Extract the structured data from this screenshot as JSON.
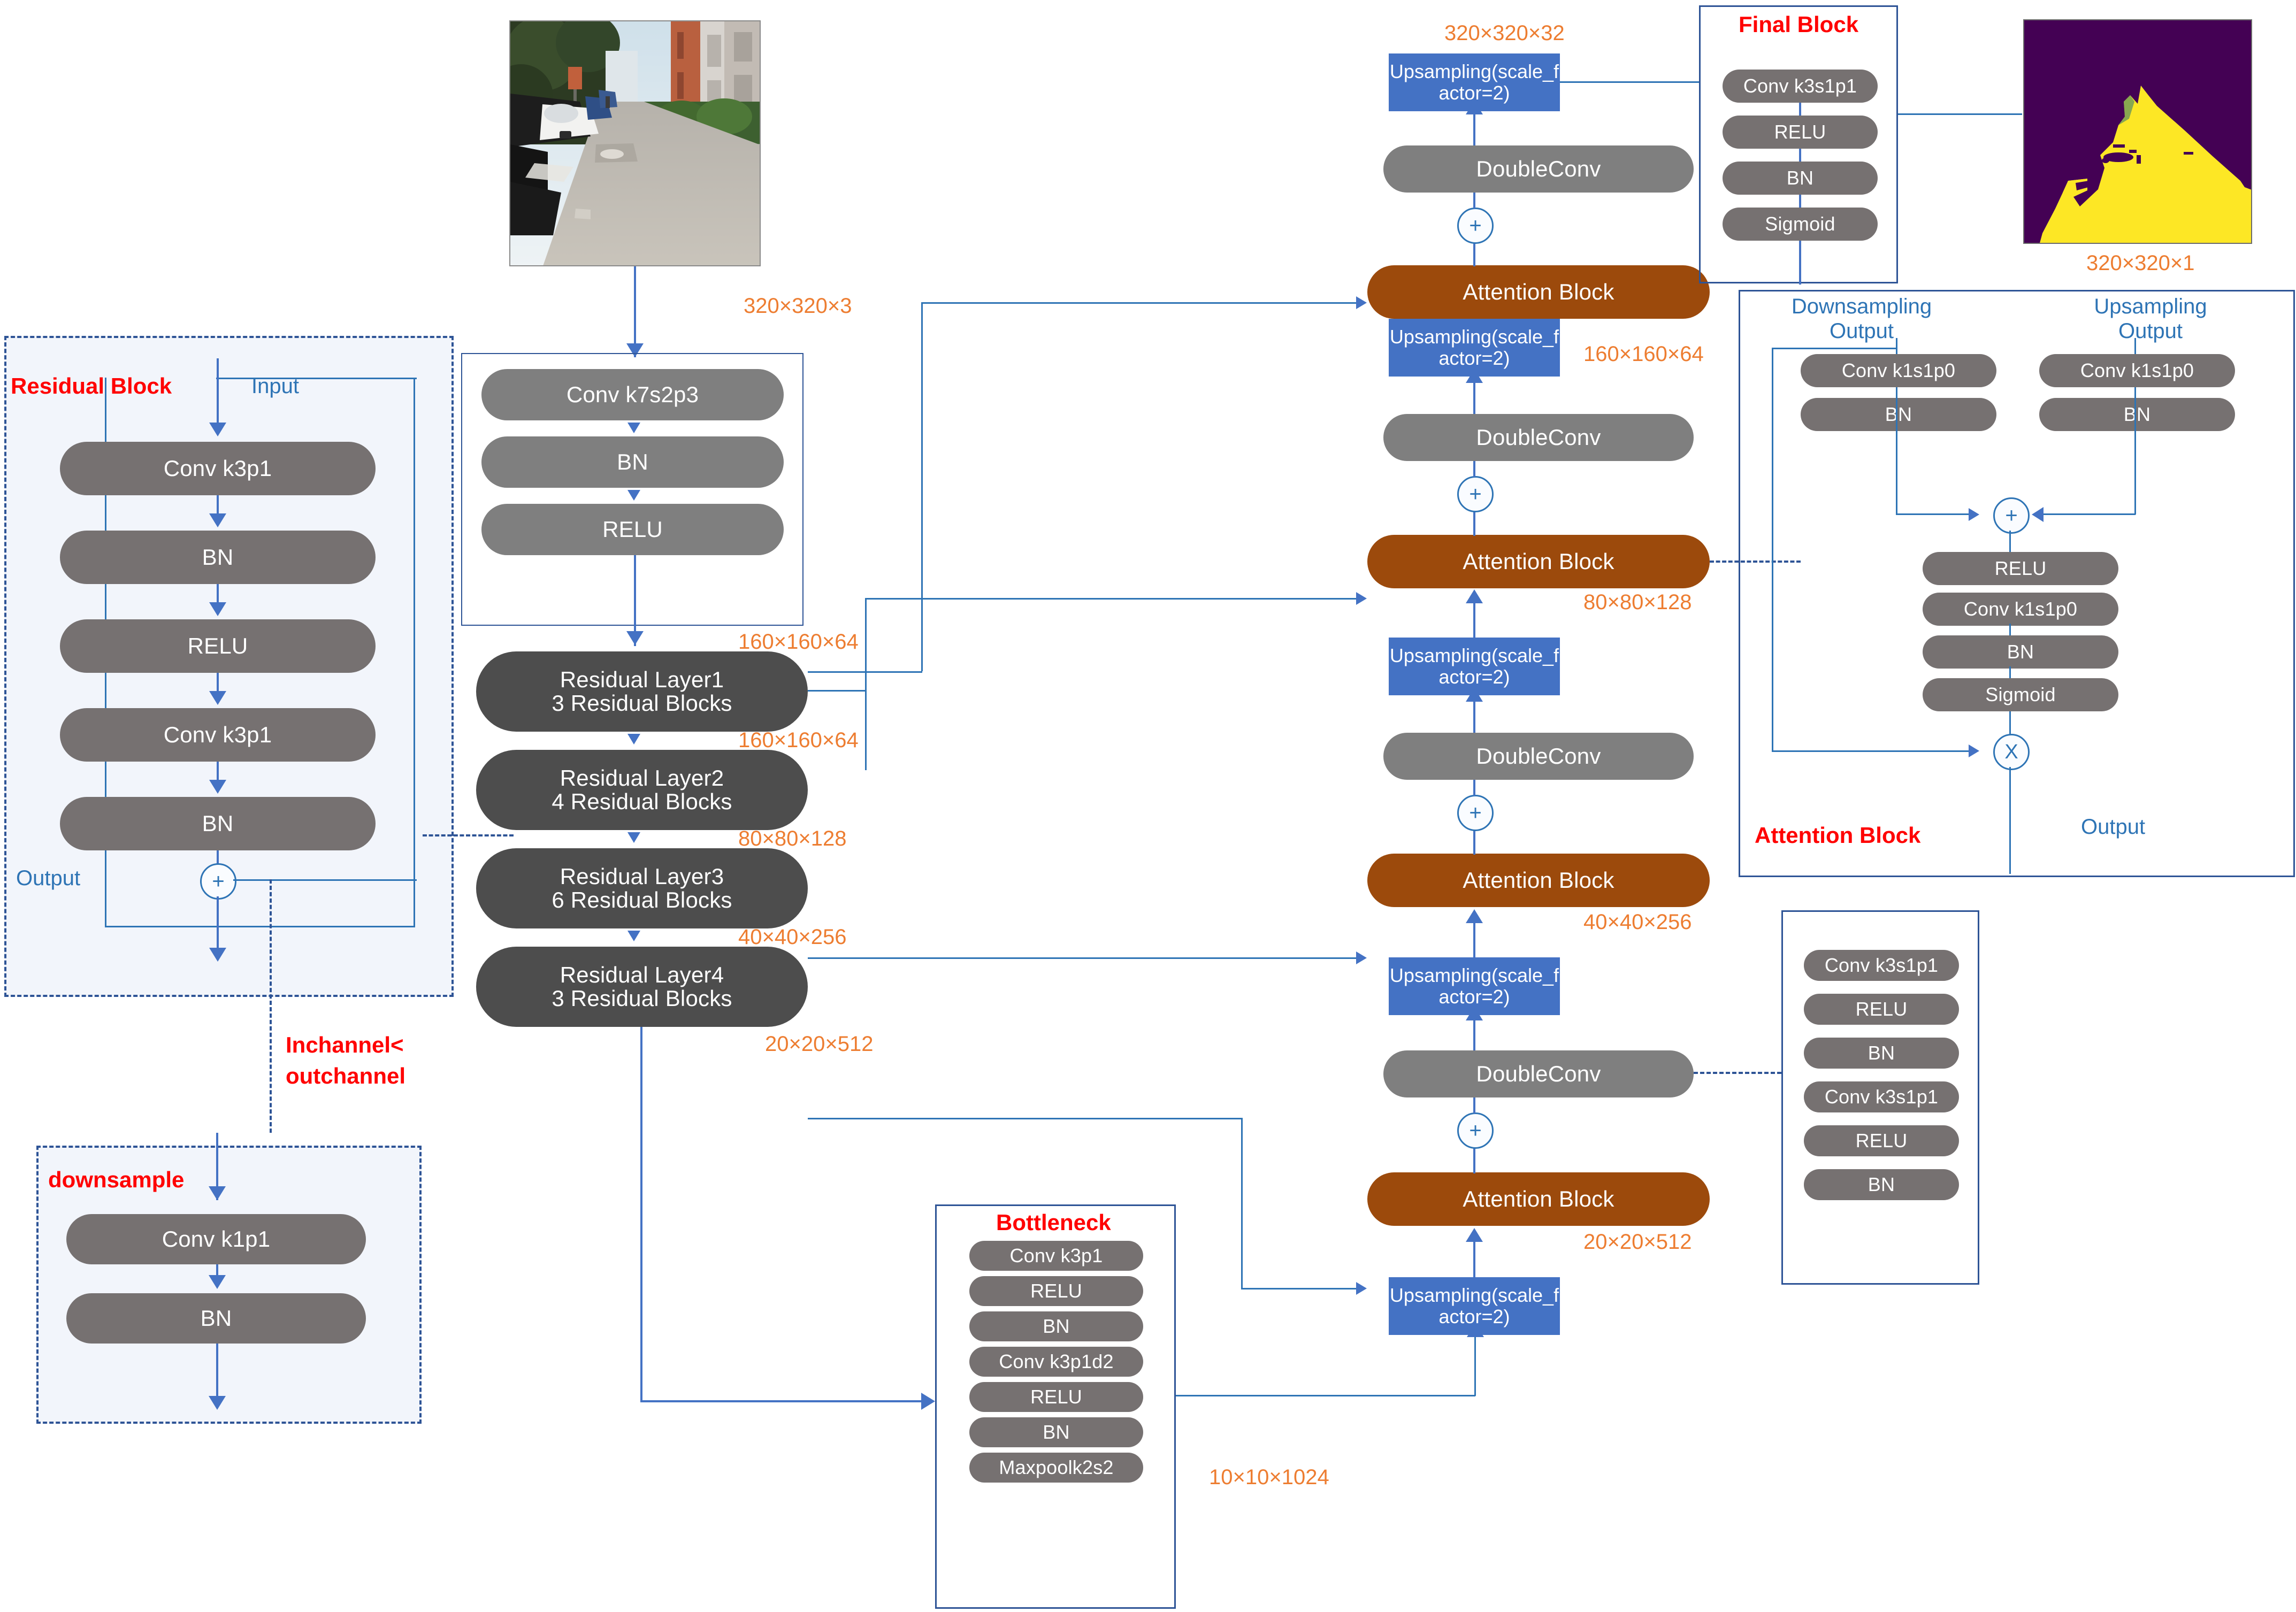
{
  "figure": {
    "type": "neural-network-architecture-diagram",
    "title": "Attention ResUNet segmentation architecture"
  },
  "encoder": {
    "input_image_caption": "320×320×3",
    "stem": {
      "layers": [
        "Conv k7s2p3",
        "BN",
        "RELU"
      ],
      "output_label": "160×160×64"
    },
    "residual_layers": [
      {
        "name": "Residual Layer1",
        "blocks": "3 Residual Blocks",
        "output_label": "160×160×64"
      },
      {
        "name": "Residual Layer2",
        "blocks": "4 Residual Blocks",
        "output_label": "80×80×128"
      },
      {
        "name": "Residual Layer3",
        "blocks": "6 Residual Blocks",
        "output_label": "40×40×256"
      },
      {
        "name": "Residual Layer4",
        "blocks": "3 Residual Blocks",
        "output_label": "20×20×512"
      }
    ]
  },
  "residual_block_panel": {
    "title": "Residual Block",
    "input_label": "Input",
    "output_label": "Output",
    "layers": [
      "Conv k3p1",
      "BN",
      "RELU",
      "Conv k3p1",
      "BN"
    ],
    "sum_symbol": "+",
    "condition_label": "Inchannel<\noutchannel",
    "condition_line1": "Inchannel<",
    "condition_line2": "outchannel"
  },
  "downsample_panel": {
    "title": "downsample",
    "layers": [
      "Conv k1p1",
      "BN"
    ]
  },
  "bottleneck_panel": {
    "title": "Bottleneck",
    "layers": [
      "Conv k3p1",
      "RELU",
      "BN",
      "Conv k3p1d2",
      "RELU",
      "BN",
      "Maxpoolk2s2"
    ],
    "output_label": "10×10×1024"
  },
  "decoder": {
    "upsampling_label": "Upsampling(scale_f\nactor=2)",
    "upsampling_line1": "Upsampling(scale_f",
    "upsampling_line2": "actor=2)",
    "doubleconv_label": "DoubleConv",
    "attention_label": "Attention Block",
    "sum_symbol": "+",
    "stages": [
      {
        "attention": "Attention Block",
        "skip_label": "160×160×64",
        "up": "Upsampling(scale_factor=2)",
        "dc": "DoubleConv"
      },
      {
        "attention": "Attention Block",
        "skip_label": "80×80×128",
        "up": "Upsampling(scale_factor=2)",
        "dc": "DoubleConv"
      },
      {
        "attention": "Attention Block",
        "skip_label": "40×40×256",
        "up": "Upsampling(scale_factor=2)",
        "dc": "DoubleConv"
      },
      {
        "attention": "Attention Block",
        "skip_label": "20×20×512",
        "up": "Upsampling(scale_factor=2)",
        "dc": "DoubleConv"
      }
    ],
    "top_label": "320×320×32"
  },
  "final_block_panel": {
    "title": "Final Block",
    "layers": [
      "Conv k3s1p1",
      "RELU",
      "BN",
      "Sigmoid"
    ]
  },
  "doubleconv_panel": {
    "layers": [
      "Conv k3s1p1",
      "RELU",
      "BN",
      "Conv k3s1p1",
      "RELU",
      "BN"
    ]
  },
  "attention_block_panel": {
    "title": "Attention Block",
    "left_input_line1": "Downsampling",
    "left_input_line2": "Output",
    "right_input_line1": "Upsampling",
    "right_input_line2": "Output",
    "output_label": "Output",
    "left_layers": [
      "Conv k1s1p0",
      "BN"
    ],
    "right_layers": [
      "Conv k1s1p0",
      "BN"
    ],
    "merge_symbol": "+",
    "trunk_layers": [
      "RELU",
      "Conv k1s1p0",
      "BN",
      "Sigmoid"
    ],
    "multiply_symbol": "X"
  },
  "output_image_caption": "320×320×1",
  "colors": {
    "pill_grey": "#767171",
    "pill_light_grey": "#7F7F7F",
    "residual_dark": "#4D4D4D",
    "attention_brown": "#9C4A0C",
    "upsample_blue": "#4472C4",
    "connector_blue": "#2E74B5",
    "dim_label_orange": "#ED7D31",
    "title_red": "#FF0000",
    "panel_border": "#2E5496",
    "mask_background": "#440154",
    "mask_foreground": "#FDE725"
  }
}
